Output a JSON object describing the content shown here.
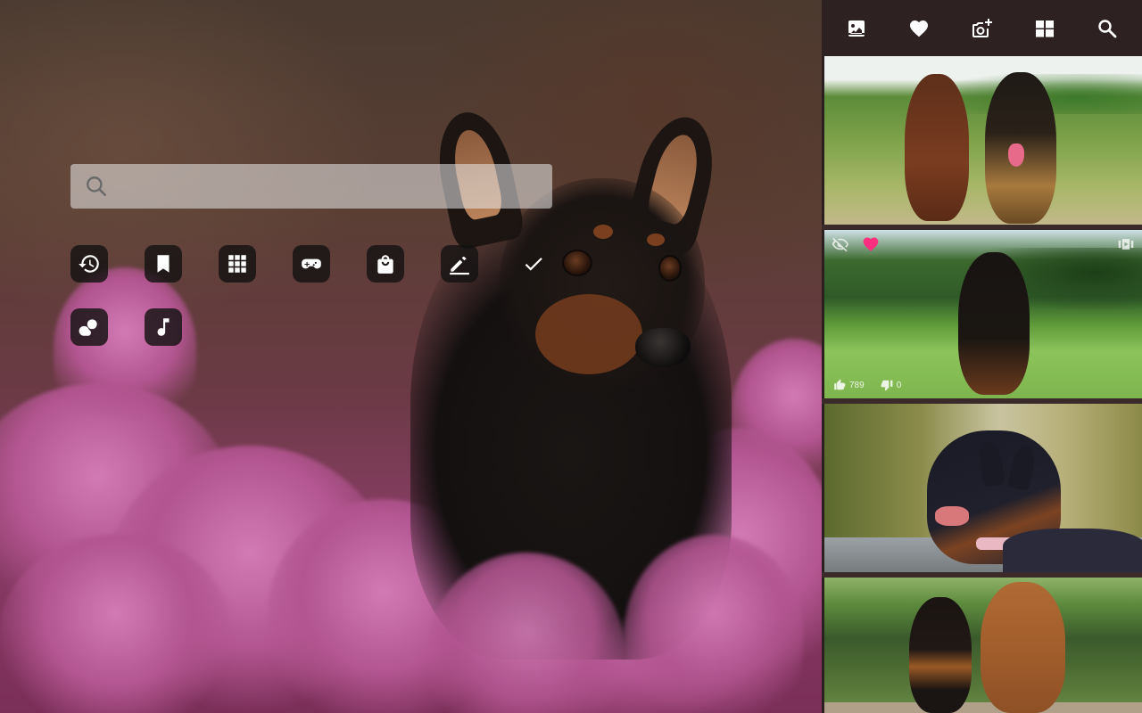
{
  "search": {
    "placeholder": "",
    "value": ""
  },
  "quick_links": [
    {
      "name": "history",
      "icon": "history-icon"
    },
    {
      "name": "bookmarks",
      "icon": "bookmark-icon"
    },
    {
      "name": "apps",
      "icon": "apps-grid-icon"
    },
    {
      "name": "games",
      "icon": "gamepad-icon"
    },
    {
      "name": "shopping",
      "icon": "shopping-bag-icon"
    },
    {
      "name": "notes",
      "icon": "pencil-icon"
    },
    {
      "name": "tasks",
      "icon": "checkmark-icon"
    },
    {
      "name": "weather",
      "icon": "weather-icon"
    },
    {
      "name": "music",
      "icon": "music-note-icon"
    }
  ],
  "toolbar": [
    {
      "name": "wallpaper",
      "icon": "wallpaper-icon"
    },
    {
      "name": "favorites",
      "icon": "heart-icon"
    },
    {
      "name": "add-photo",
      "icon": "add-photo-icon"
    },
    {
      "name": "gallery",
      "icon": "windows-grid-icon"
    },
    {
      "name": "search",
      "icon": "search-icon"
    }
  ],
  "photos": [
    {
      "id": "photo-1"
    },
    {
      "id": "photo-2",
      "likes": "789",
      "dislikes": "0",
      "overlay_icons": [
        "hide-icon",
        "favorite-heart-icon",
        "slideshow-icon"
      ]
    },
    {
      "id": "photo-3"
    },
    {
      "id": "photo-4"
    }
  ],
  "colors": {
    "panel_bg": "#2d2221",
    "favorite_heart": "#ff2e7e",
    "icon_button_bg": "#141212"
  }
}
